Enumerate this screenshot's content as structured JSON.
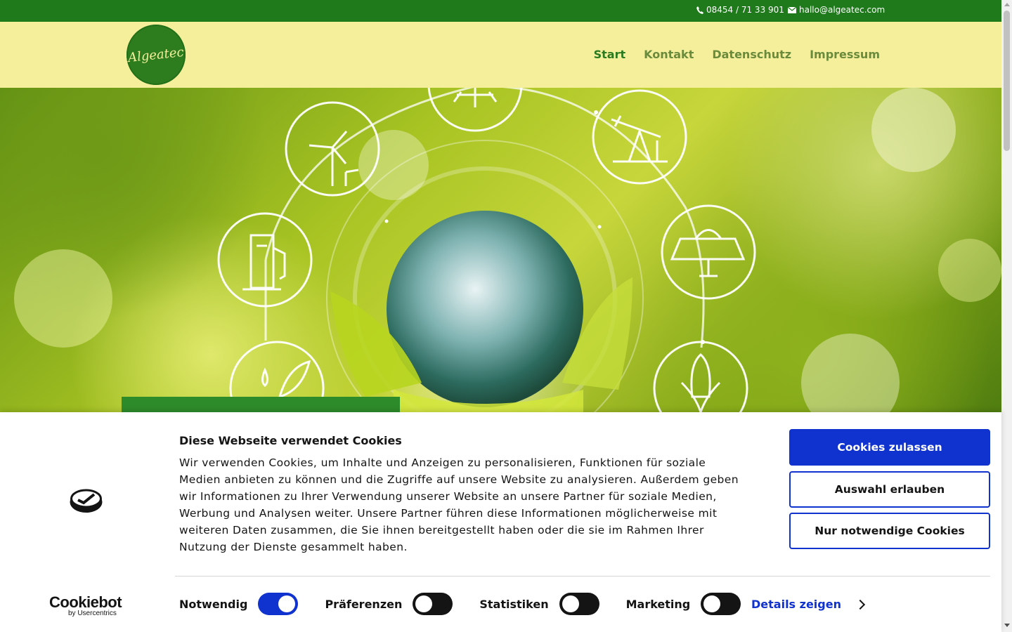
{
  "topbar": {
    "phone": "08454 / 71 33 901",
    "email": "hallo@algeatec.com"
  },
  "header": {
    "logo_text": "Algeatec",
    "nav": [
      {
        "label": "Start",
        "active": true
      },
      {
        "label": "Kontakt",
        "active": false
      },
      {
        "label": "Datenschutz",
        "active": false
      },
      {
        "label": "Impressum",
        "active": false
      }
    ]
  },
  "hero": {
    "icons": [
      "sun-icon",
      "wind-turbine-icon",
      "oil-pump-icon",
      "fuel-pump-icon",
      "solar-panel-icon",
      "water-leaf-icon",
      "corn-icon",
      "globe-icon"
    ]
  },
  "cookie": {
    "title": "Diese Webseite verwendet Cookies",
    "body": "Wir verwenden Cookies, um Inhalte und Anzeigen zu personalisieren, Funktionen für soziale Medien anbieten zu können und die Zugriffe auf unsere Website zu analysieren. Außerdem geben wir Informationen zu Ihrer Verwendung unserer Website an unsere Partner für soziale Medien, Werbung und Analysen weiter. Unsere Partner führen diese Informationen möglicherweise mit weiteren Daten zusammen, die Sie ihnen bereitgestellt haben oder die sie im Rahmen Ihrer Nutzung der Dienste gesammelt haben.",
    "buttons": {
      "allow_all": "Cookies zulassen",
      "allow_selection": "Auswahl erlauben",
      "necessary_only": "Nur notwendige Cookies"
    },
    "toggles": [
      {
        "label": "Notwendig",
        "on": true
      },
      {
        "label": "Präferenzen",
        "on": false
      },
      {
        "label": "Statistiken",
        "on": false
      },
      {
        "label": "Marketing",
        "on": false
      }
    ],
    "details_link": "Details zeigen",
    "brand": {
      "name": "Cookiebot",
      "by": "by Usercentrics"
    }
  },
  "colors": {
    "topbar": "#1f7a1c",
    "header": "#f5ef9b",
    "accent_blue": "#1032cf",
    "nav_active": "#2c7a1f",
    "nav": "#6a8a3c"
  }
}
